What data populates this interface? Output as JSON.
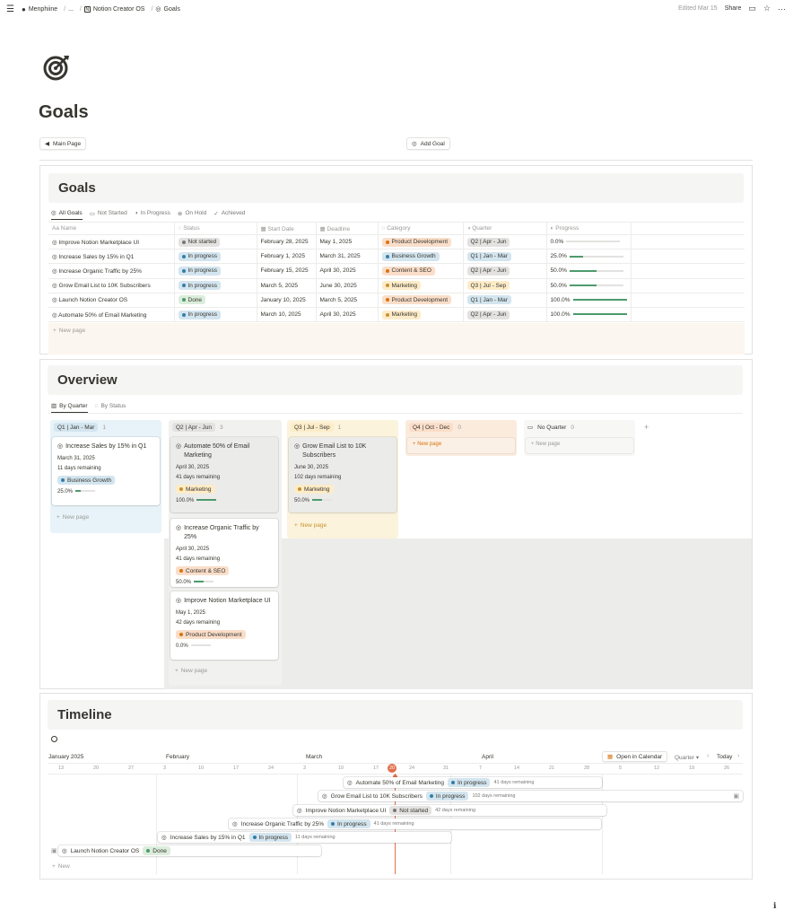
{
  "topbar": {
    "crumbs": [
      "Menphiine",
      "...",
      "Notion Creator OS",
      "Goals"
    ],
    "edited": "Edited Mar 15",
    "share": "Share"
  },
  "page": {
    "title": "Goals",
    "main_page_button": "Main Page",
    "add_goal_button": "Add Goal"
  },
  "goals": {
    "heading": "Goals",
    "tabs": [
      "All Goals",
      "Not Started",
      "In Progress",
      "On Hold",
      "Achieved"
    ],
    "columns": [
      "Name",
      "Status",
      "Start Date",
      "Deadline",
      "Category",
      "Quarter",
      "Progress"
    ],
    "rows": [
      {
        "name": "Improve Notion Marketplace UI",
        "status": "Not started",
        "start": "February 28, 2025",
        "deadline": "May 1, 2025",
        "category": "Product Development",
        "quarter": "Q2 | Apr - Jun",
        "progress": "0.0%",
        "progress_value": 0
      },
      {
        "name": "Increase Sales by 15% in Q1",
        "status": "In progress",
        "start": "February 1, 2025",
        "deadline": "March 31, 2025",
        "category": "Business Growth",
        "quarter": "Q1 | Jan - Mar",
        "progress": "25.0%",
        "progress_value": 0.25
      },
      {
        "name": "Increase Organic Traffic by 25%",
        "status": "In progress",
        "start": "February 15, 2025",
        "deadline": "April 30, 2025",
        "category": "Content & SEO",
        "quarter": "Q2 | Apr - Jun",
        "progress": "50.0%",
        "progress_value": 0.5
      },
      {
        "name": "Grow Email List to 10K Subscribers",
        "status": "In progress",
        "start": "March 5, 2025",
        "deadline": "June 30, 2025",
        "category": "Marketing",
        "quarter": "Q3 | Jul - Sep",
        "progress": "50.0%",
        "progress_value": 0.5
      },
      {
        "name": "Launch Notion Creator OS",
        "status": "Done",
        "start": "January 10, 2025",
        "deadline": "March 5, 2025",
        "category": "Product Development",
        "quarter": "Q1 | Jan - Mar",
        "progress": "100.0%",
        "progress_value": 1
      },
      {
        "name": "Automate 50% of Email Marketing",
        "status": "In progress",
        "start": "March 10, 2025",
        "deadline": "April 30, 2025",
        "category": "Marketing",
        "quarter": "Q2 | Apr - Jun",
        "progress": "100.0%",
        "progress_value": 1
      }
    ],
    "new_page": "New page"
  },
  "overview": {
    "heading": "Overview",
    "tabs": [
      "By Quarter",
      "By Status"
    ],
    "groups": [
      {
        "label": "Q1 | Jan - Mar",
        "count": "1"
      },
      {
        "label": "Q2 | Apr - Jun",
        "count": "3"
      },
      {
        "label": "Q3 | Jul - Sep",
        "count": "1"
      },
      {
        "label": "Q4 | Oct - Dec",
        "count": "0"
      },
      {
        "label": "No Quarter",
        "count": "0"
      }
    ],
    "cards": [
      {
        "title": "Increase Sales by 15% in Q1",
        "date": "March 31, 2025",
        "remaining": "11 days remaining",
        "category": "Business Growth",
        "progress": "25.0%",
        "progress_value": 0.25
      },
      {
        "title": "Automate 50% of Email Marketing",
        "date": "April 30, 2025",
        "remaining": "41 days remaining",
        "category": "Marketing",
        "progress": "100.0%",
        "progress_value": 1
      },
      {
        "title": "Increase Organic Traffic by 25%",
        "date": "April 30, 2025",
        "remaining": "41 days remaining",
        "category": "Content & SEO",
        "progress": "50.0%",
        "progress_value": 0.5
      },
      {
        "title": "Improve Notion Marketplace UI",
        "date": "May 1, 2025",
        "remaining": "42 days remaining",
        "category": "Product Development",
        "progress": "0.0%",
        "progress_value": 0
      },
      {
        "title": "Grow Email List to 10K Subscribers",
        "date": "June 30, 2025",
        "remaining": "102 days remaining",
        "category": "Marketing",
        "progress": "50.0%",
        "progress_value": 0.5
      }
    ],
    "new_page": "New page"
  },
  "timeline": {
    "heading": "Timeline",
    "months": [
      "January 2025",
      "February",
      "March",
      "April"
    ],
    "days": [
      "13",
      "20",
      "27",
      "3",
      "10",
      "17",
      "24",
      "3",
      "10",
      "17",
      "20",
      "24",
      "31",
      "7",
      "14",
      "21",
      "28",
      "5",
      "12",
      "19",
      "26"
    ],
    "open_calendar": "Open in Calendar",
    "quarter": "Quarter",
    "today": "Today",
    "bars": [
      {
        "name": "Automate 50% of Email Marketing",
        "status": "In progress",
        "remaining": "41 days remaining"
      },
      {
        "name": "Grow Email List to 10K Subscribers",
        "status": "In progress",
        "remaining": "102 days remaining"
      },
      {
        "name": "Improve Notion Marketplace UI",
        "status": "Not started",
        "remaining": "42 days remaining"
      },
      {
        "name": "Increase Organic Traffic by 25%",
        "status": "In progress",
        "remaining": "41 days remaining"
      },
      {
        "name": "Increase Sales by 15% in Q1",
        "status": "In progress",
        "remaining": "11 days remaining"
      },
      {
        "name": "Launch Notion Creator OS",
        "status": "Done",
        "remaining": ""
      }
    ],
    "new": "New"
  },
  "colors": {
    "status_blue_bg": "#d3e5ef",
    "status_gray_bg": "#e3e2e0",
    "status_green_bg": "#dbeddb",
    "cat_product_bg": "#fadec9",
    "cat_business_bg": "#d3e5ef",
    "cat_content_bg": "#fadec9",
    "cat_marketing_bg": "#fdecc8",
    "q1_bg": "#e7f3f8",
    "q2_bg": "#f1f1ef",
    "q3_bg": "#fbf3db",
    "q4_bg": "#faebdd",
    "today_red": "#e16f4c",
    "progress_green": "#4d9a6b"
  }
}
